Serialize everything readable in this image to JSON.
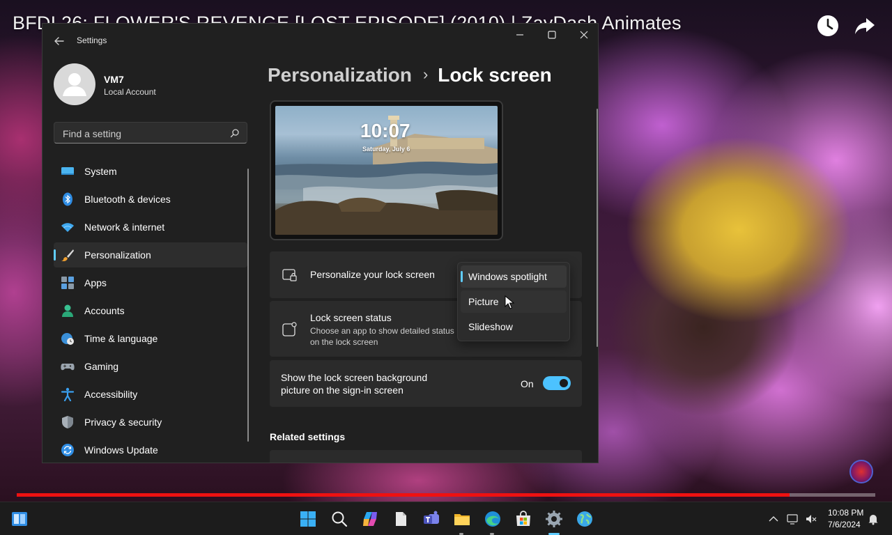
{
  "video": {
    "title": "BFDI 26: FLOWER'S REVENGE [LOST EPISODE] (2010) | ZayDash Animates",
    "progress_fraction": 0.9,
    "icons": [
      "clock-icon",
      "share-arrow-icon"
    ]
  },
  "settings": {
    "app_title": "Settings",
    "user": {
      "name": "VM7",
      "account_type": "Local Account"
    },
    "search": {
      "placeholder": "Find a setting"
    },
    "nav": [
      {
        "label": "System",
        "icon": "monitor-icon"
      },
      {
        "label": "Bluetooth & devices",
        "icon": "bluetooth-icon"
      },
      {
        "label": "Network & internet",
        "icon": "wifi-icon"
      },
      {
        "label": "Personalization",
        "icon": "paintbrush-icon",
        "active": true
      },
      {
        "label": "Apps",
        "icon": "apps-icon"
      },
      {
        "label": "Accounts",
        "icon": "person-icon"
      },
      {
        "label": "Time & language",
        "icon": "globe-clock-icon"
      },
      {
        "label": "Gaming",
        "icon": "gamepad-icon"
      },
      {
        "label": "Accessibility",
        "icon": "accessibility-icon"
      },
      {
        "label": "Privacy & security",
        "icon": "shield-icon"
      },
      {
        "label": "Windows Update",
        "icon": "sync-icon"
      }
    ],
    "breadcrumb": {
      "parent": "Personalization",
      "separator": "›",
      "current": "Lock screen"
    },
    "preview": {
      "time": "10:07",
      "date": "Saturday, July 6"
    },
    "personalize": {
      "title": "Personalize your lock screen",
      "options": [
        "Windows spotlight",
        "Picture",
        "Slideshow"
      ],
      "selected": "Windows spotlight",
      "hovered": "Picture"
    },
    "status": {
      "title": "Lock screen status",
      "description": "Choose an app to show detailed status on the lock screen"
    },
    "signin": {
      "text": "Show the lock screen background picture on the sign-in screen",
      "toggle_label": "On",
      "toggle_on": true
    },
    "related": {
      "heading": "Related settings"
    }
  },
  "taskbar": {
    "apps": [
      "windows-start-icon",
      "search-icon",
      "copilot-icon",
      "file-icon",
      "teams-icon",
      "file-explorer-icon",
      "edge-icon",
      "store-icon",
      "settings-gear-icon",
      "globe-icon"
    ],
    "clock": {
      "time": "10:08 PM",
      "date": "7/6/2024"
    }
  },
  "colors": {
    "accent": "#60cdff",
    "toggle": "#4cc2ff",
    "progress": "#ee1111",
    "window_bg": "#202020"
  }
}
